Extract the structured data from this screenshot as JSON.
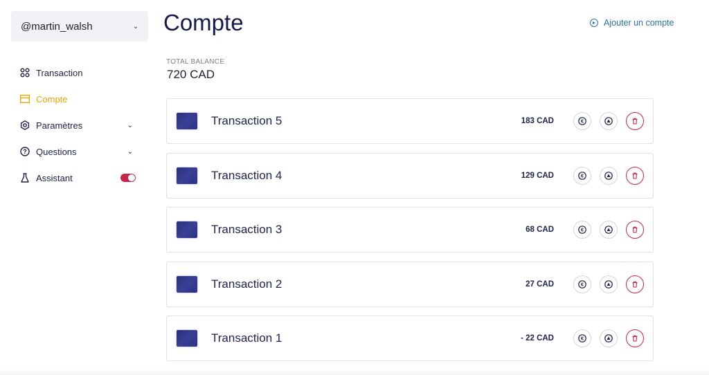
{
  "user": {
    "handle": "@martin_walsh"
  },
  "nav": [
    {
      "label": "Transaction",
      "icon": "grid-icon",
      "active": false
    },
    {
      "label": "Compte",
      "icon": "layout-icon",
      "active": true
    },
    {
      "label": "Paramètres",
      "icon": "gear-icon",
      "active": false,
      "expandable": true
    },
    {
      "label": "Questions",
      "icon": "help-icon",
      "active": false,
      "expandable": true
    },
    {
      "label": "Assistant",
      "icon": "flask-icon",
      "active": false,
      "toggle": true,
      "toggle_on": true
    }
  ],
  "page": {
    "title": "Compte",
    "add_account_label": "Ajouter un compte",
    "balance_label": "TOTAL BALANCE",
    "balance_value": "720 CAD"
  },
  "transactions": [
    {
      "title": "Transaction 5",
      "amount": "183 CAD"
    },
    {
      "title": "Transaction 4",
      "amount": "129 CAD"
    },
    {
      "title": "Transaction 3",
      "amount": "68 CAD"
    },
    {
      "title": "Transaction 2",
      "amount": "27 CAD"
    },
    {
      "title": "Transaction 1",
      "amount": "- 22 CAD"
    }
  ],
  "colors": {
    "accent": "#f0a500",
    "primary": "#141a4d",
    "danger": "#c7254e",
    "link": "#2a6fb0"
  }
}
